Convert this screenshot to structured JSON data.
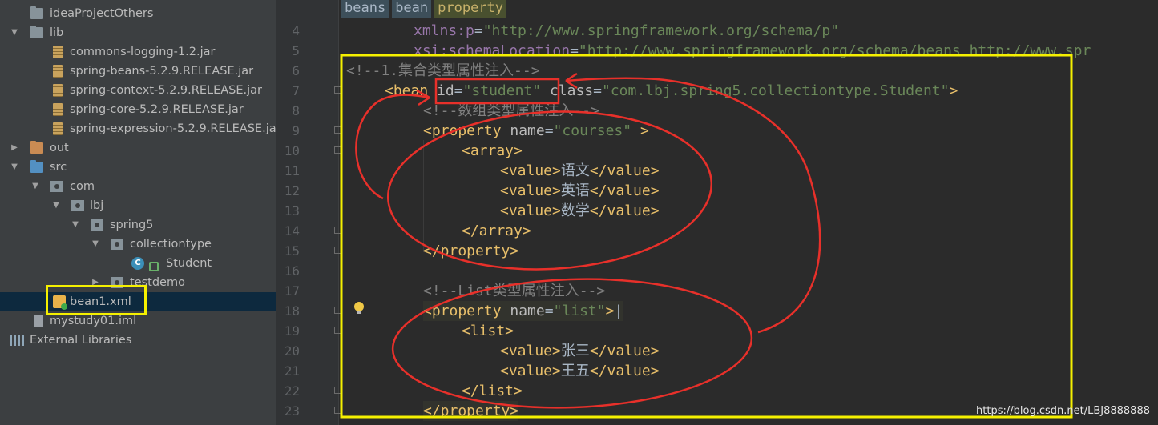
{
  "project_tree": {
    "items": [
      {
        "label": "ideaProjectOthers"
      },
      {
        "label": "lib"
      },
      {
        "label": "commons-logging-1.2.jar"
      },
      {
        "label": "spring-beans-5.2.9.RELEASE.jar"
      },
      {
        "label": "spring-context-5.2.9.RELEASE.jar"
      },
      {
        "label": "spring-core-5.2.9.RELEASE.jar"
      },
      {
        "label": "spring-expression-5.2.9.RELEASE.jar"
      },
      {
        "label": "out"
      },
      {
        "label": "src"
      },
      {
        "label": "com"
      },
      {
        "label": "lbj"
      },
      {
        "label": "spring5"
      },
      {
        "label": "collectiontype"
      },
      {
        "label": "Student"
      },
      {
        "label": "testdemo"
      },
      {
        "label": "bean1.xml"
      },
      {
        "label": "mystudy01.iml"
      },
      {
        "label": "External Libraries"
      }
    ]
  },
  "editor": {
    "breadcrumb": [
      "beans",
      "bean",
      "property"
    ],
    "line_numbers": [
      "4",
      "5",
      "6",
      "7",
      "8",
      "9",
      "10",
      "11",
      "12",
      "13",
      "14",
      "15",
      "16",
      "17",
      "18",
      "19",
      "20",
      "21",
      "22",
      "23"
    ],
    "lines": {
      "l4_ns": "xmlns:p",
      "l4_val": "\"http://www.springframework.org/schema/p\"",
      "l5_ns": "xsi:schemaLocation",
      "l5_val": "\"http://www.springframework.org/schema/beans http://www.spr",
      "l6": "<!--1.集合类型属性注入-->",
      "l7_attr": "id",
      "l7_val": "\"student\"",
      "l7_attr2": "class",
      "l7_val2": "\"com.lbj.spring5.collectiontype.Student\"",
      "l8": "<!--数组类型属性注入-->",
      "l9_attr": "name",
      "l9_val": "\"courses\"",
      "l11_text": "语文",
      "l12_text": "英语",
      "l13_text": "数学",
      "l17": "<!--List类型属性注入-->",
      "l18_attr": "name",
      "l18_val": "\"list\"",
      "l20_text": "张三",
      "l21_text": "王五"
    }
  },
  "watermark": "https://blog.csdn.net/LBJ8888888",
  "colors": {
    "annotation_red": "#e8302a",
    "annotation_yellow": "#f5f000"
  }
}
